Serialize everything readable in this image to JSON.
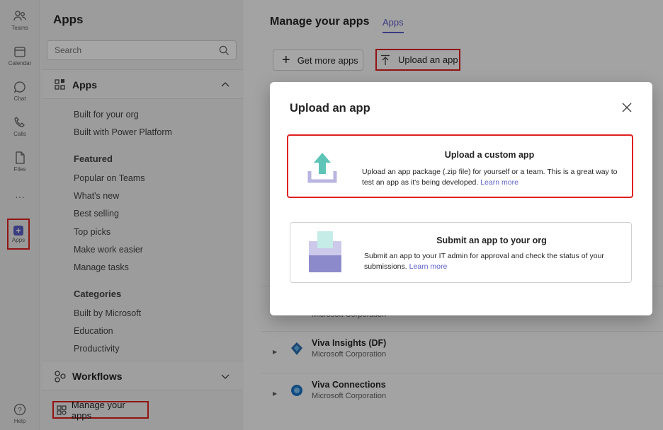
{
  "rail": {
    "items": [
      {
        "label": "Teams",
        "icon": "teams-icon"
      },
      {
        "label": "Calendar",
        "icon": "calendar-icon"
      },
      {
        "label": "Chat",
        "icon": "chat-icon"
      },
      {
        "label": "Calls",
        "icon": "calls-icon"
      },
      {
        "label": "Files",
        "icon": "files-icon"
      },
      {
        "label": "Apps",
        "icon": "apps-icon"
      },
      {
        "label": "Help",
        "icon": "help-icon"
      }
    ],
    "more": "···"
  },
  "left": {
    "title": "Apps",
    "search_placeholder": "Search",
    "apps_section": "Apps",
    "links_top": [
      "Built for your org",
      "Built with Power Platform"
    ],
    "featured_head": "Featured",
    "featured": [
      "Popular on Teams",
      "What's new",
      "Best selling",
      "Top picks",
      "Make work easier",
      "Manage tasks"
    ],
    "categories_head": "Categories",
    "categories": [
      "Built by Microsoft",
      "Education",
      "Productivity"
    ],
    "workflows": "Workflows",
    "manage_apps": "Manage your apps"
  },
  "main": {
    "title": "Manage your apps",
    "tab": "Apps",
    "get_more": "Get more apps",
    "upload": "Upload an app",
    "partial_publisher": "Microsoft Corporation",
    "rows": [
      {
        "name": "Viva Insights (DF)",
        "publisher": "Microsoft Corporation"
      },
      {
        "name": "Viva Connections",
        "publisher": "Microsoft Corporation"
      }
    ]
  },
  "dialog": {
    "title": "Upload an app",
    "custom": {
      "title": "Upload a custom app",
      "desc": "Upload an app package (.zip file) for yourself or a team. This is a great way to test an app as it's being developed.",
      "link": "Learn more"
    },
    "submit": {
      "title": "Submit an app to your org",
      "desc": "Submit an app to your IT admin for approval and check the status of your submissions.",
      "link": "Learn more"
    }
  },
  "colors": {
    "accent": "#5b5fc7",
    "highlight": "#e02020"
  }
}
